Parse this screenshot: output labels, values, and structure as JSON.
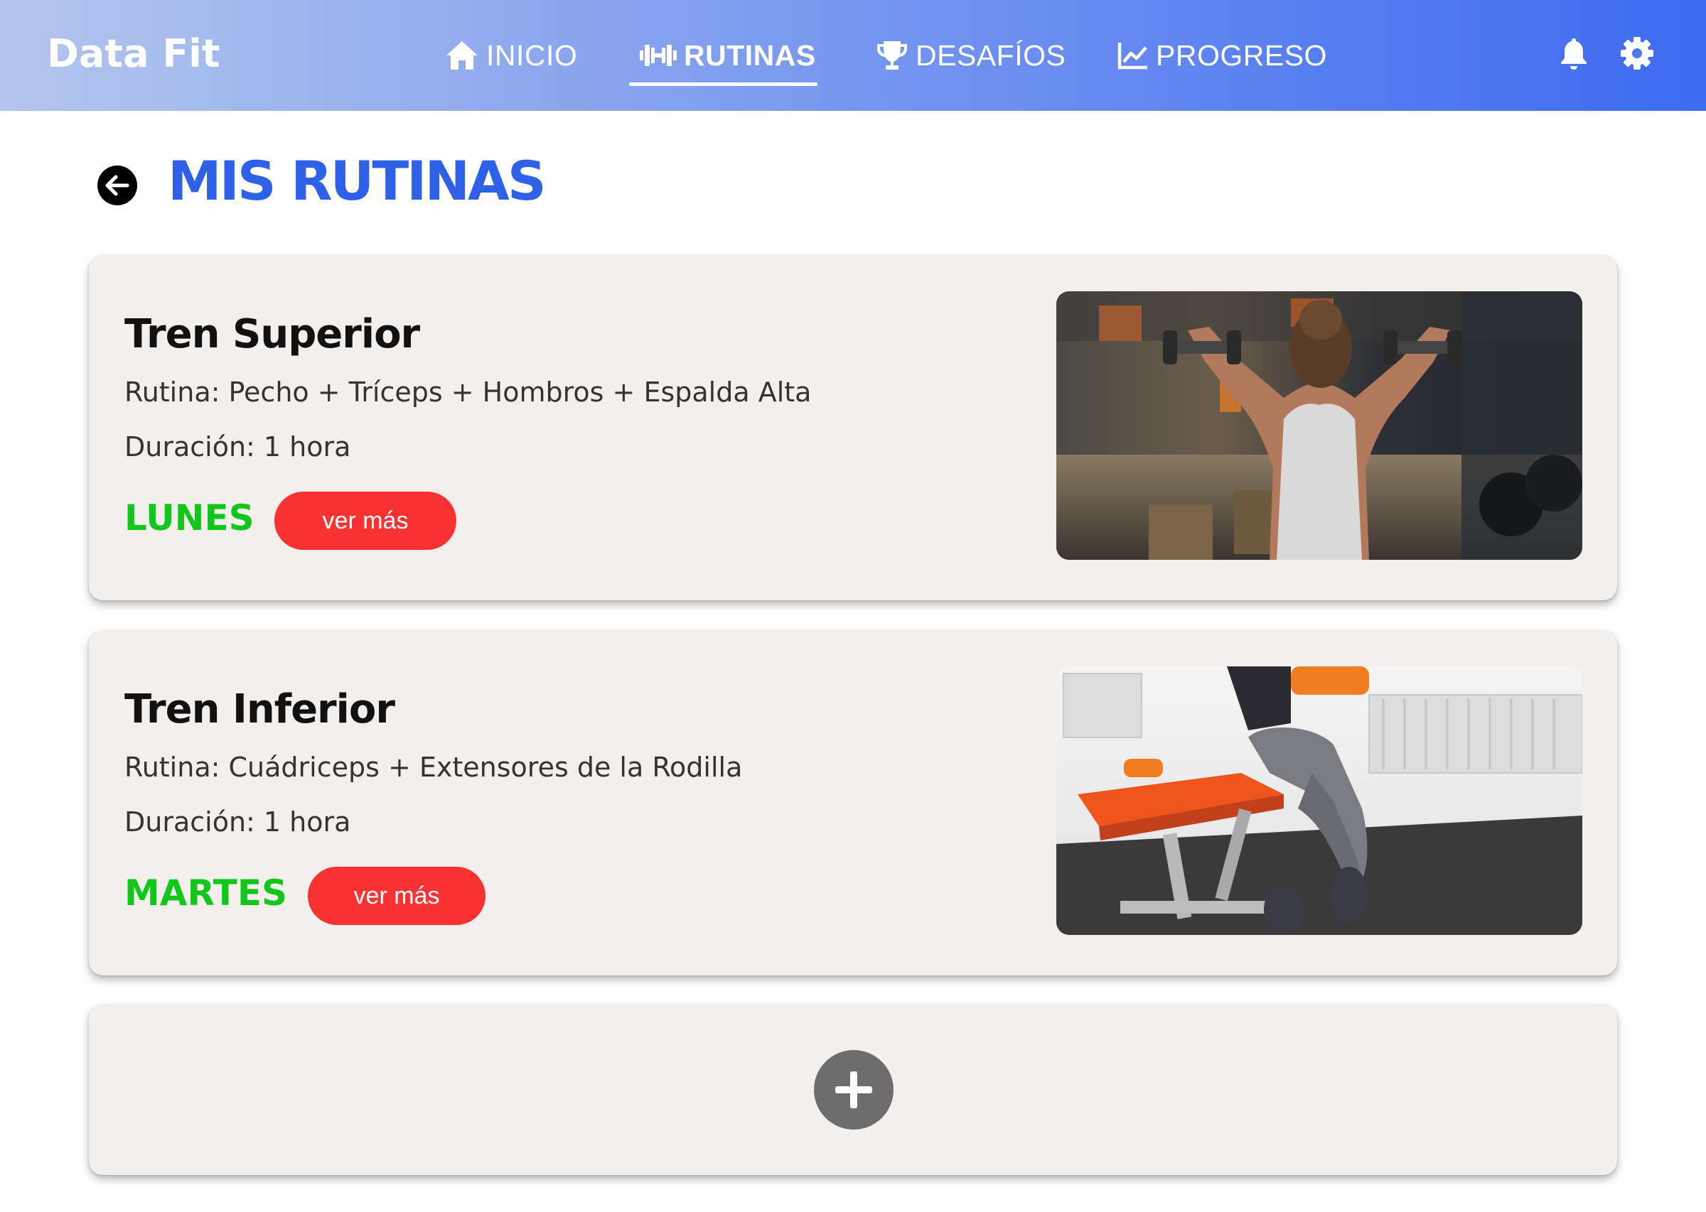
{
  "app": {
    "brand": "Data Fit"
  },
  "nav": {
    "items": [
      {
        "label": "INICIO",
        "icon": "home-icon"
      },
      {
        "label": "RUTINAS",
        "icon": "dumbbell-icon",
        "active": true
      },
      {
        "label": "DESAFÍOS",
        "icon": "trophy-icon"
      },
      {
        "label": "PROGRESO",
        "icon": "chart-line-icon"
      }
    ],
    "actions": [
      {
        "icon": "bell-icon"
      },
      {
        "icon": "gear-icon"
      }
    ]
  },
  "page": {
    "title": "MIS RUTINAS",
    "back_icon": "arrow-left-icon"
  },
  "routines": [
    {
      "title": "Tren Superior",
      "routine": "Rutina: Pecho + Tríceps + Hombros + Espalda Alta",
      "duration": "Duración: 1 hora",
      "day": "LUNES",
      "button": "ver más",
      "image": "woman lifting dumbbells overhead in gym"
    },
    {
      "title": "Tren Inferior",
      "routine": "Rutina: Cuádriceps + Extensores de la Rodilla",
      "duration": "Duración: 1 hora",
      "day": "MARTES",
      "button": "ver más",
      "image": "woman seated on orange workout bench"
    }
  ],
  "add_card": {
    "icon": "plus-icon"
  },
  "colors": {
    "accent": "#2f61e8",
    "day": "#12c71b",
    "button": "#f83232",
    "card": "#f2efed",
    "add_button": "#6d6d6d"
  }
}
